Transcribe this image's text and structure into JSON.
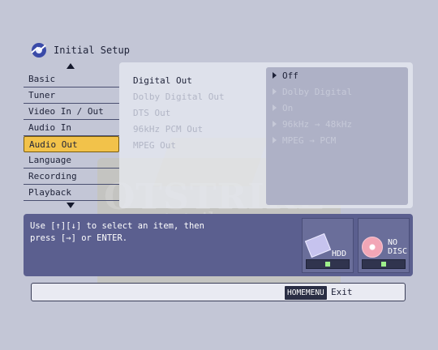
{
  "header": {
    "title": "Initial Setup",
    "icon": "setup-gear-icon"
  },
  "sidebar": {
    "items": [
      {
        "label": "Basic"
      },
      {
        "label": "Tuner"
      },
      {
        "label": "Video In / Out"
      },
      {
        "label": "Audio In"
      },
      {
        "label": "Audio Out",
        "selected": true
      },
      {
        "label": "Language"
      },
      {
        "label": "Recording"
      },
      {
        "label": "Playback"
      }
    ]
  },
  "options": {
    "items": [
      {
        "label": "Digital Out",
        "value": "Off"
      },
      {
        "label": "Dolby Digital Out",
        "value": "Dolby Digital"
      },
      {
        "label": "DTS Out",
        "value": "On"
      },
      {
        "label": "96kHz PCM Out",
        "value": "96kHz → 48kHz"
      },
      {
        "label": "MPEG Out",
        "value": "MPEG → PCM"
      }
    ]
  },
  "help": {
    "text": "Use [↑][↓] to select an item, then\npress [→] or ENTER."
  },
  "devices": {
    "hdd": {
      "label": "HDD",
      "icon": "hdd-icon"
    },
    "disc": {
      "label": "NO\nDISC",
      "icon": "disc-icon"
    }
  },
  "footer": {
    "homemenu_label": "HOMEMENU",
    "exit_label": "Exit"
  },
  "watermark": {
    "text": "OTSTRIKE",
    "url": "otstrike.com"
  },
  "colors": {
    "selected": "#f2c24a",
    "help_panel": "#5b5f8f",
    "background": "#c3c6d6"
  }
}
